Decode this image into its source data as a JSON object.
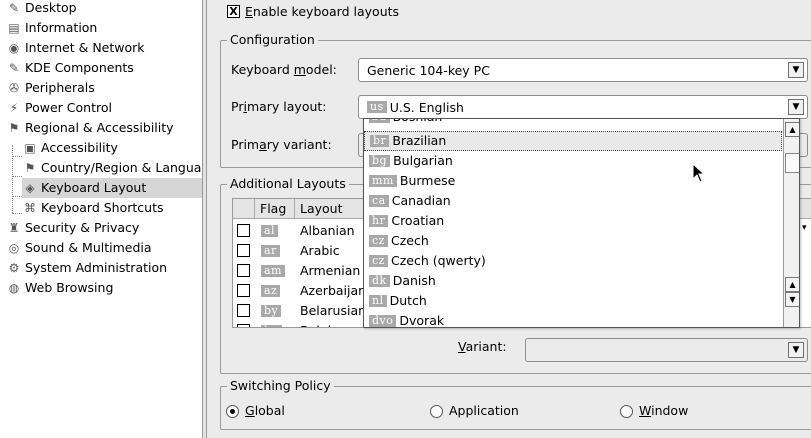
{
  "sidebar": {
    "items": [
      {
        "label": "Desktop",
        "icon": "desktop-icon",
        "glyph": "✎",
        "level": 0
      },
      {
        "label": "Information",
        "icon": "information-icon",
        "glyph": "▤",
        "level": 0
      },
      {
        "label": "Internet & Network",
        "icon": "internet-network-icon",
        "glyph": "◉",
        "level": 0
      },
      {
        "label": "KDE Components",
        "icon": "kde-components-icon",
        "glyph": "✎",
        "level": 0
      },
      {
        "label": "Peripherals",
        "icon": "peripherals-icon",
        "glyph": "✇",
        "level": 0
      },
      {
        "label": "Power Control",
        "icon": "power-control-icon",
        "glyph": "⚡",
        "level": 0
      },
      {
        "label": "Regional & Accessibility",
        "icon": "regional-accessibility-icon",
        "glyph": "⚑",
        "level": 0
      },
      {
        "label": "Accessibility",
        "icon": "accessibility-icon",
        "glyph": "▣",
        "level": 1
      },
      {
        "label": "Country/Region & Language",
        "icon": "country-region-icon",
        "glyph": "⚑",
        "level": 1
      },
      {
        "label": "Keyboard Layout",
        "icon": "keyboard-layout-icon",
        "glyph": "◈",
        "level": 1,
        "selected": true
      },
      {
        "label": "Keyboard Shortcuts",
        "icon": "keyboard-shortcuts-icon",
        "glyph": "⌘",
        "level": 1
      },
      {
        "label": "Security & Privacy",
        "icon": "security-privacy-icon",
        "glyph": "♜",
        "level": 0
      },
      {
        "label": "Sound & Multimedia",
        "icon": "sound-multimedia-icon",
        "glyph": "◎",
        "level": 0
      },
      {
        "label": "System Administration",
        "icon": "system-administration-icon",
        "glyph": "⚙",
        "level": 0
      },
      {
        "label": "Web Browsing",
        "icon": "web-browsing-icon",
        "glyph": "◍",
        "level": 0
      }
    ]
  },
  "enable": {
    "label_underlined": "E",
    "label_rest": "nable keyboard layouts",
    "checked": "X"
  },
  "configuration": {
    "title": "Configuration",
    "model_label_pre": "Keyboard ",
    "model_label_u": "m",
    "model_label_post": "odel:",
    "model_value": "Generic 104-key PC",
    "layout_label_pre": "Pr",
    "layout_label_u": "i",
    "layout_label_post": "mary layout:",
    "layout_flag": "us",
    "layout_value": "U.S. English",
    "variant_label_pre": "Prim",
    "variant_label_u": "a",
    "variant_label_post": "ry variant:"
  },
  "additional": {
    "title": "Additional Layouts",
    "col_flag": "Flag",
    "col_layout": "Layout",
    "rows": [
      {
        "flag": "al",
        "layout": "Albanian"
      },
      {
        "flag": "ar",
        "layout": "Arabic"
      },
      {
        "flag": "am",
        "layout": "Armenian"
      },
      {
        "flag": "az",
        "layout": "Azerbaijan"
      },
      {
        "flag": "by",
        "layout": "Belarusian"
      },
      {
        "flag": "be",
        "layout": "Belgian"
      }
    ],
    "variant_label": "Variant:",
    "variant_label_u": "V"
  },
  "dropdown": {
    "partial_top": {
      "flag": "ba",
      "label": "Bosnian"
    },
    "items": [
      {
        "flag": "br",
        "label": "Brazilian",
        "highlighted": true
      },
      {
        "flag": "bg",
        "label": "Bulgarian"
      },
      {
        "flag": "mm",
        "label": "Burmese"
      },
      {
        "flag": "ca",
        "label": "Canadian"
      },
      {
        "flag": "hr",
        "label": "Croatian"
      },
      {
        "flag": "cz",
        "label": "Czech"
      },
      {
        "flag": "cz",
        "label": "Czech (qwerty)"
      },
      {
        "flag": "dk",
        "label": "Danish"
      },
      {
        "flag": "nl",
        "label": "Dutch"
      },
      {
        "flag": "dvo",
        "label": "Dvorak"
      }
    ]
  },
  "switching": {
    "title": "Switching Policy",
    "options": [
      {
        "label_u": "G",
        "label_rest": "lobal",
        "selected": true
      },
      {
        "label_u": "",
        "label_rest": "Application",
        "selected": false
      },
      {
        "label_u": "W",
        "label_rest": "indow",
        "selected": false
      }
    ]
  }
}
